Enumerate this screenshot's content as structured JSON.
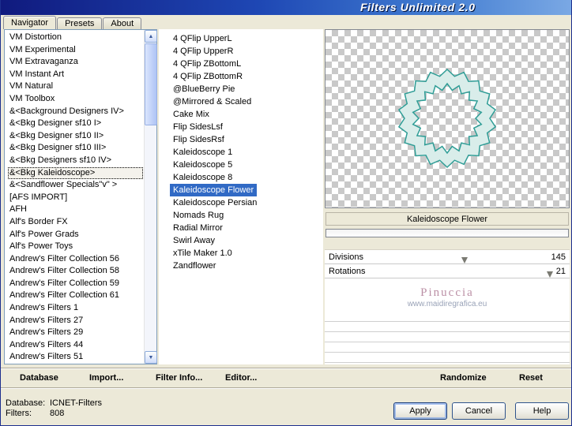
{
  "window": {
    "title": "Filters Unlimited 2.0"
  },
  "tabs": [
    {
      "label": "Navigator",
      "active": true
    },
    {
      "label": "Presets",
      "active": false
    },
    {
      "label": "About",
      "active": false
    }
  ],
  "navigator": {
    "categories": [
      "VM Distortion",
      "VM Experimental",
      "VM Extravaganza",
      "VM Instant Art",
      "VM Natural",
      "VM Toolbox",
      "&<Background Designers IV>",
      "&<Bkg Designer sf10 I>",
      "&<Bkg Designer sf10 II>",
      "&<Bkg Designer sf10 III>",
      "&<Bkg Designers sf10 IV>",
      "&<Bkg Kaleidoscope>",
      "&<Sandflower Specials\"v\" >",
      "[AFS IMPORT]",
      "AFH",
      "Alf's Border FX",
      "Alf's Power Grads",
      "Alf's Power Toys",
      "Andrew's Filter Collection 56",
      "Andrew's Filter Collection 58",
      "Andrew's Filter Collection 59",
      "Andrew's Filter Collection 61",
      "Andrew's Filters 1",
      "Andrew's Filters 27",
      "Andrew's Filters 29",
      "Andrew's Filters 44",
      "Andrew's Filters 51"
    ],
    "selected_category": "&<Bkg Kaleidoscope>",
    "filters": [
      "4 QFlip UpperL",
      "4 QFlip UpperR",
      "4 QFlip ZBottomL",
      "4 QFlip ZBottomR",
      "@BlueBerry Pie",
      "@Mirrored & Scaled",
      "Cake Mix",
      "Flip SidesLsf",
      "Flip SidesRsf",
      "Kaleidoscope 1",
      "Kaleidoscope 5",
      "Kaleidoscope 8",
      "Kaleidoscope Flower",
      "Kaleidoscope Persian",
      "Nomads Rug",
      "Radial Mirror",
      "Swirl Away",
      "xTile Maker 1.0",
      "Zandflower"
    ],
    "selected_filter": "Kaleidoscope Flower"
  },
  "preview": {
    "shape_stroke": "#2f9d96",
    "shape_fill": "#d9edea"
  },
  "controls": {
    "filter_name": "Kaleidoscope Flower",
    "params": [
      {
        "label": "Divisions",
        "value": "145",
        "thumb_pct": 57
      },
      {
        "label": "Rotations",
        "value": "21",
        "thumb_pct": 92
      }
    ],
    "watermark_line1": "Pinuccia",
    "watermark_line2": "www.maidiregrafica.eu"
  },
  "toolbar": {
    "database": "Database",
    "import": "Import...",
    "filter_info": "Filter Info...",
    "editor": "Editor...",
    "randomize": "Randomize",
    "reset": "Reset"
  },
  "status": {
    "database_label": "Database:",
    "database_value": "ICNET-Filters",
    "filters_label": "Filters:",
    "filters_value": "808"
  },
  "buttons": {
    "apply": "Apply",
    "cancel": "Cancel",
    "help": "Help"
  }
}
